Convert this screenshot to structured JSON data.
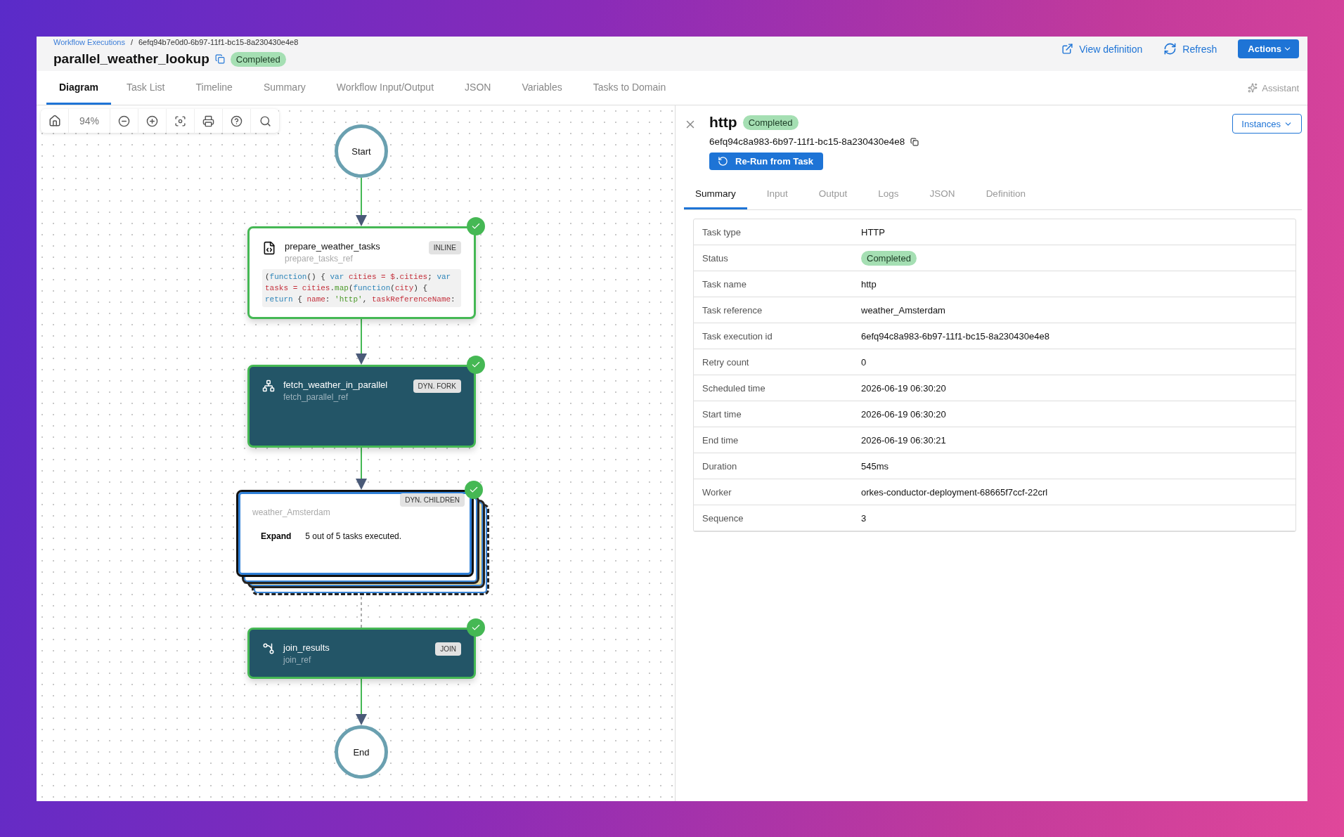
{
  "breadcrumb": {
    "link": "Workflow Executions",
    "separator": "/",
    "current": "6efq94b7e0d0-6b97-11f1-bc15-8a230430e4e8"
  },
  "title": "parallel_weather_lookup",
  "status": "Completed",
  "header_actions": {
    "view_definition": "View definition",
    "refresh": "Refresh",
    "actions": "Actions"
  },
  "tabs": [
    {
      "label": "Diagram",
      "selected": true
    },
    {
      "label": "Task List",
      "selected": false
    },
    {
      "label": "Timeline",
      "selected": false
    },
    {
      "label": "Summary",
      "selected": false
    },
    {
      "label": "Workflow Input/Output",
      "selected": false
    },
    {
      "label": "JSON",
      "selected": false
    },
    {
      "label": "Variables",
      "selected": false
    },
    {
      "label": "Tasks to Domain",
      "selected": false
    }
  ],
  "assistant": "Assistant",
  "toolbar": {
    "zoom": "94%"
  },
  "diagram": {
    "start": "Start",
    "end": "End",
    "tasks": [
      {
        "kind": "inline",
        "name": "prepare_weather_tasks",
        "ref": "prepare_tasks_ref",
        "badge": "INLINE",
        "completed": true,
        "code": [
          "(function() { var cities = $.cities; var",
          "tasks = cities.map(function(city) {",
          "return { name: 'http', taskReferenceName:"
        ]
      },
      {
        "kind": "fork",
        "name": "fetch_weather_in_parallel",
        "ref": "fetch_parallel_ref",
        "badge": "DYN. FORK",
        "completed": true
      },
      {
        "kind": "children",
        "ref": "weather_Amsterdam",
        "badge": "DYN. CHILDREN",
        "completed": true,
        "expand": "Expand",
        "summary": "5 out of 5 tasks executed."
      },
      {
        "kind": "join",
        "name": "join_results",
        "ref": "join_ref",
        "badge": "JOIN",
        "completed": true
      }
    ]
  },
  "panel": {
    "title": "http",
    "status": "Completed",
    "id": "6efq94c8a983-6b97-11f1-bc15-8a230430e4e8",
    "rerun": "Re-Run from Task",
    "instances": "Instances",
    "tabs": [
      {
        "label": "Summary",
        "selected": true
      },
      {
        "label": "Input",
        "selected": false
      },
      {
        "label": "Output",
        "selected": false
      },
      {
        "label": "Logs",
        "selected": false
      },
      {
        "label": "JSON",
        "selected": false
      },
      {
        "label": "Definition",
        "selected": false
      }
    ],
    "rows": [
      {
        "label": "Task type",
        "value": "HTTP",
        "kind": "text"
      },
      {
        "label": "Status",
        "value": "Completed",
        "kind": "badge"
      },
      {
        "label": "Task name",
        "value": "http",
        "kind": "text"
      },
      {
        "label": "Task reference",
        "value": "weather_Amsterdam",
        "kind": "text"
      },
      {
        "label": "Task execution id",
        "value": "6efq94c8a983-6b97-11f1-bc15-8a230430e4e8",
        "kind": "text"
      },
      {
        "label": "Retry count",
        "value": "0",
        "kind": "text"
      },
      {
        "label": "Scheduled time",
        "value": "2026-06-19 06:30:20",
        "kind": "text"
      },
      {
        "label": "Start time",
        "value": "2026-06-19 06:30:20",
        "kind": "text"
      },
      {
        "label": "End time",
        "value": "2026-06-19 06:30:21",
        "kind": "text"
      },
      {
        "label": "Duration",
        "value": "545ms",
        "kind": "text"
      },
      {
        "label": "Worker",
        "value": "orkes-conductor-deployment-68665f7ccf-22crl",
        "kind": "text"
      },
      {
        "label": "Sequence",
        "value": "3",
        "kind": "text"
      }
    ]
  }
}
